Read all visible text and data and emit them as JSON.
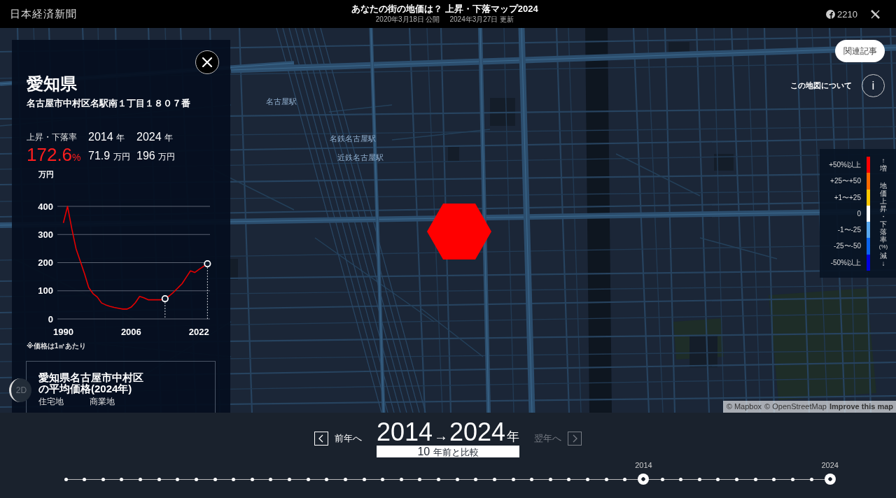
{
  "header": {
    "logo": "日本経済新聞",
    "title": "あなたの街の地価は？ 上昇・下落マップ2024",
    "published": "2020年3月18日 公開",
    "updated": "2024年3月27日 更新",
    "share_count": "2210"
  },
  "map": {
    "station_labels": [
      "名古屋駅",
      "名鉄名古屋駅",
      "近鉄名古屋駅"
    ],
    "hexagons": [
      {
        "color": "#ff0000"
      }
    ],
    "related_button": "関連記事",
    "about_label": "この地図について",
    "about_button": "i",
    "view_toggle": "2D",
    "attribution": [
      {
        "text": "© Mapbox",
        "kind": "credit"
      },
      {
        "text": "© OpenStreetMap",
        "kind": "credit"
      },
      {
        "text": "Improve this map",
        "kind": "feedback"
      }
    ]
  },
  "panel": {
    "prefecture": "愛知県",
    "address": "名古屋市中村区名駅南１丁目１８０７番",
    "stats": {
      "rate_label": "上昇・下落率",
      "rate": "172.6",
      "rate_unit": "%",
      "years": [
        {
          "year": "2014",
          "unit": "年",
          "price": "71.9",
          "price_unit": "万円"
        },
        {
          "year": "2024",
          "unit": "年",
          "price": "196",
          "price_unit": "万円"
        }
      ]
    },
    "chart_data": {
      "type": "line",
      "ylabel": "万円",
      "x": [
        1990,
        1991,
        1992,
        1993,
        1994,
        1995,
        1996,
        1997,
        1998,
        1999,
        2000,
        2001,
        2002,
        2003,
        2004,
        2005,
        2006,
        2007,
        2008,
        2009,
        2010,
        2011,
        2012,
        2013,
        2014,
        2015,
        2016,
        2017,
        2018,
        2019,
        2020,
        2021,
        2022,
        2023,
        2024
      ],
      "series": [
        {
          "color": "#e60000",
          "values": [
            341,
            400,
            320,
            250,
            205,
            160,
            111,
            90,
            78,
            57,
            50,
            45,
            41,
            38,
            35,
            35,
            42,
            58,
            80,
            75,
            68,
            68,
            68,
            68,
            72,
            82,
            95,
            110,
            125,
            148,
            171,
            165,
            176,
            186,
            196
          ]
        }
      ],
      "xlim": [
        1988.6,
        2024.6
      ],
      "ylim": [
        0,
        400
      ],
      "xticks": [
        1990,
        2006,
        2022
      ],
      "yticks": [
        0,
        100,
        200,
        300,
        400
      ],
      "grid": true
    },
    "note": "※価格は1㎡あたり",
    "average": {
      "title": "愛知県名古屋市中村区の平均価格(2024年)",
      "columns": [
        "住宅地",
        "商業地"
      ]
    }
  },
  "legend": {
    "items": [
      {
        "label": "+50%以上",
        "color": "#ff0000"
      },
      {
        "label": "+25〜+50",
        "color": "#ff6a00"
      },
      {
        "label": "+1〜+25",
        "color": "#ffc800"
      },
      {
        "label": "0",
        "color": "#ffffff"
      },
      {
        "label": "-1〜-25",
        "color": "#5aaaf0"
      },
      {
        "label": "-25〜-50",
        "color": "#0a64f0"
      },
      {
        "label": "-50%以上",
        "color": "#0000e0"
      }
    ],
    "top": "↑増",
    "title": "地価上昇・下落率",
    "unit": "(%)",
    "bottom": "減↓"
  },
  "timeline": {
    "prev": {
      "label": "前年へ",
      "disabled": false
    },
    "next": {
      "label": "翌年へ",
      "disabled": true
    },
    "from_year": "2014",
    "arrow": "→",
    "to_year": "2024",
    "unit": "年",
    "compare_years": "10",
    "compare_text": "年前と比較",
    "points": [
      {
        "selected": false
      },
      {
        "selected": false
      },
      {
        "selected": false
      },
      {
        "selected": false
      },
      {
        "selected": false
      },
      {
        "selected": false
      },
      {
        "selected": false
      },
      {
        "selected": false
      },
      {
        "selected": false
      },
      {
        "selected": false
      },
      {
        "selected": false
      },
      {
        "selected": false
      },
      {
        "selected": false
      },
      {
        "selected": false
      },
      {
        "selected": false
      },
      {
        "selected": false
      },
      {
        "selected": false
      },
      {
        "selected": false
      },
      {
        "selected": false
      },
      {
        "selected": false
      },
      {
        "selected": false
      },
      {
        "selected": false
      },
      {
        "selected": false
      },
      {
        "selected": false
      },
      {
        "selected": false
      },
      {
        "selected": false
      },
      {
        "selected": false
      },
      {
        "selected": false
      },
      {
        "selected": false
      },
      {
        "selected": false
      },
      {
        "selected": false
      },
      {
        "selected": true,
        "label": "2014"
      },
      {
        "selected": false
      },
      {
        "selected": false
      },
      {
        "selected": false
      },
      {
        "selected": false
      },
      {
        "selected": false
      },
      {
        "selected": false
      },
      {
        "selected": false
      },
      {
        "selected": false
      },
      {
        "selected": false
      },
      {
        "selected": true,
        "label": "2024"
      }
    ]
  }
}
